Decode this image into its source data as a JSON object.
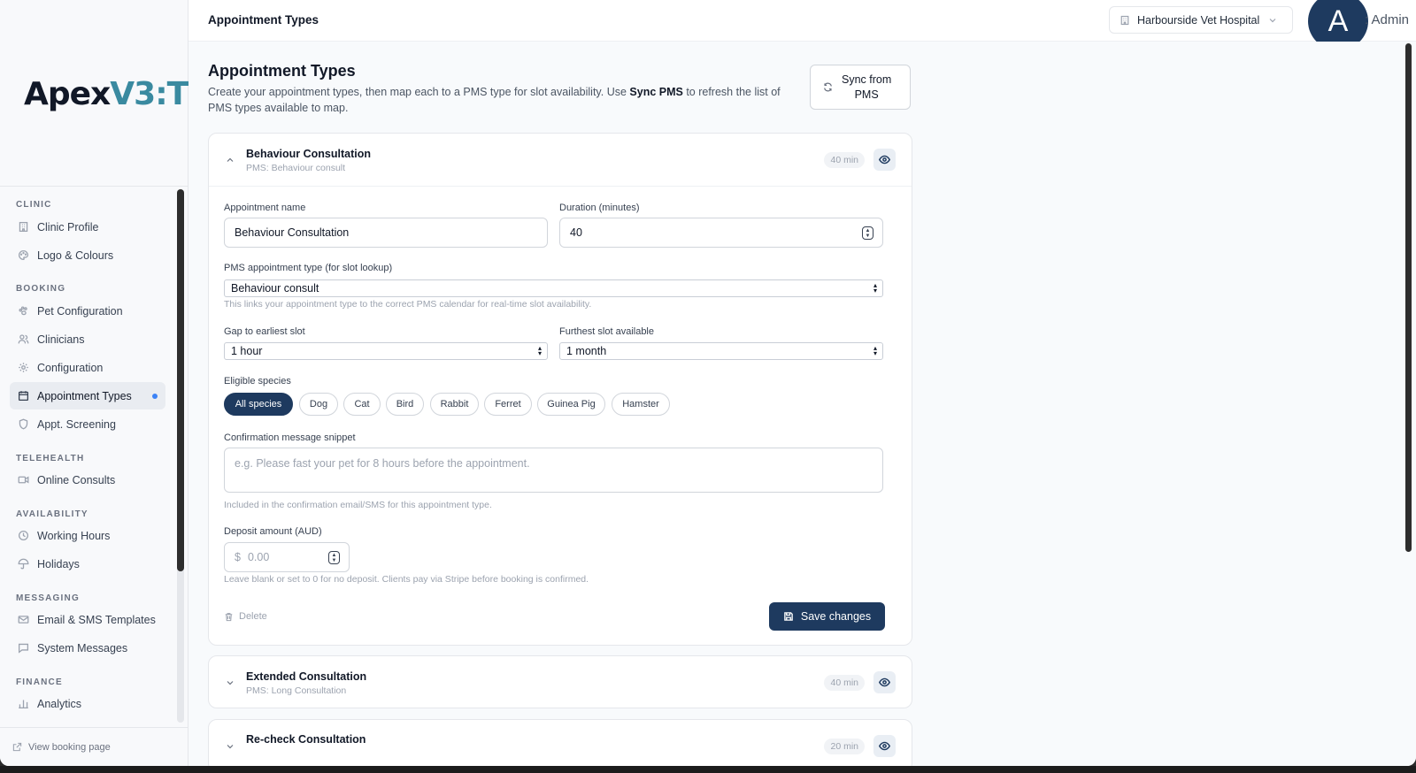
{
  "logo": {
    "part1": "Apex",
    "part2": "V3:T"
  },
  "topbar": {
    "title": "Appointment Types",
    "clinic": "Harbourside Vet Hospital",
    "avatar_letter": "A",
    "admin_label": ": Admin"
  },
  "sidebar": {
    "sections": [
      {
        "label": "CLINIC"
      },
      {
        "label": "BOOKING"
      },
      {
        "label": "TELEHEALTH"
      },
      {
        "label": "AVAILABILITY"
      },
      {
        "label": "MESSAGING"
      },
      {
        "label": "FINANCE"
      }
    ],
    "items": [
      {
        "label": "Clinic Profile",
        "icon": "building-icon"
      },
      {
        "label": "Logo & Colours",
        "icon": "palette-icon"
      },
      {
        "label": "Pet Configuration",
        "icon": "paw-icon"
      },
      {
        "label": "Clinicians",
        "icon": "users-icon"
      },
      {
        "label": "Configuration",
        "icon": "gear-icon"
      },
      {
        "label": "Appointment Types",
        "icon": "calendar-icon",
        "active": true
      },
      {
        "label": "Appt. Screening",
        "icon": "shield-icon"
      },
      {
        "label": "Online Consults",
        "icon": "video-icon"
      },
      {
        "label": "Working Hours",
        "icon": "clock-icon"
      },
      {
        "label": "Holidays",
        "icon": "umbrella-icon"
      },
      {
        "label": "Email & SMS Templates",
        "icon": "mail-icon"
      },
      {
        "label": "System Messages",
        "icon": "message-icon"
      },
      {
        "label": "Analytics",
        "icon": "bar-chart-icon"
      }
    ],
    "view_booking": "View booking page"
  },
  "page": {
    "title": "Appointment Types",
    "desc_before": "Create your appointment types, then map each to a PMS type for slot availability. Use ",
    "desc_bold": "Sync PMS",
    "desc_after": " to refresh the list of PMS types available to map.",
    "sync_line1": "Sync from",
    "sync_line2": "PMS"
  },
  "expanded_card": {
    "title": "Behaviour Consultation",
    "pms": "PMS: Behaviour consult",
    "duration_badge": "40 min",
    "name_label": "Appointment name",
    "name_value": "Behaviour Consultation",
    "duration_label": "Duration (minutes)",
    "duration_value": "40",
    "pms_label": "PMS appointment type (for slot lookup)",
    "pms_value": "Behaviour consult",
    "pms_help": "This links your appointment type to the correct PMS calendar for real-time slot availability.",
    "gap_label": "Gap to earliest slot",
    "gap_value": "1 hour",
    "furthest_label": "Furthest slot available",
    "furthest_value": "1 month",
    "species_label": "Eligible species",
    "species": [
      "All species",
      "Dog",
      "Cat",
      "Bird",
      "Rabbit",
      "Ferret",
      "Guinea Pig",
      "Hamster"
    ],
    "confirmation_label": "Confirmation message snippet",
    "confirmation_placeholder": "e.g. Please fast your pet for 8 hours before the appointment.",
    "confirmation_help": "Included in the confirmation email/SMS for this appointment type.",
    "deposit_label": "Deposit amount (AUD)",
    "deposit_prefix": "$",
    "deposit_placeholder": "0.00",
    "deposit_help": "Leave blank or set to 0 for no deposit. Clients pay via Stripe before booking is confirmed.",
    "delete_label": "Delete",
    "save_label": "Save changes"
  },
  "collapsed_cards": [
    {
      "title": "Extended Consultation",
      "pms": "PMS: Long Consultation",
      "duration_badge": "40 min"
    },
    {
      "title": "Re-check Consultation",
      "pms": "",
      "duration_badge": "20 min"
    }
  ],
  "colors": {
    "primary": "#1e3a5f",
    "accent_dot": "#3b82f6",
    "logo_teal": "#3a8aa0"
  }
}
